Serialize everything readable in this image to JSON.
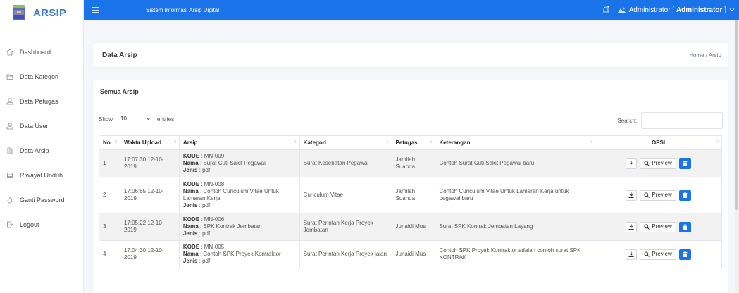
{
  "brand": {
    "name": "ARSIP"
  },
  "topbar": {
    "title": "Sistem Informasi Arsip Digital",
    "user_name": "Administrator",
    "user_role": "Administrator",
    "user_display_prefix": "Administrator [ ",
    "user_display_suffix": " ]"
  },
  "sidebar": {
    "items": [
      {
        "label": "Dashboard",
        "icon": "home-icon"
      },
      {
        "label": "Data Kategori",
        "icon": "folder-icon"
      },
      {
        "label": "Data Petugas",
        "icon": "user-icon"
      },
      {
        "label": "Data User",
        "icon": "user-icon"
      },
      {
        "label": "Data Arsip",
        "icon": "file-icon"
      },
      {
        "label": "Riwayat Unduh",
        "icon": "database-icon"
      },
      {
        "label": "Ganti Password",
        "icon": "lock-icon"
      },
      {
        "label": "Logout",
        "icon": "logout-icon"
      }
    ]
  },
  "header": {
    "title": "Data Arsip",
    "breadcrumb": "Home / Arsip"
  },
  "card": {
    "title": "Semua Arsip",
    "show_label": "Show",
    "entries_value": "10",
    "entries_label": "entries",
    "search_label": "Search:",
    "search_value": ""
  },
  "table": {
    "headers": [
      "No",
      "Waktu Upload",
      "Arsip",
      "Kategori",
      "Petugas",
      "Keterangan",
      "OPSI"
    ],
    "kode_label": "KODE",
    "nama_label": "Nama",
    "jenis_label": "Jenis",
    "preview_label": "Preview",
    "rows": [
      {
        "no": "1",
        "waktu": "17:07:30 12-10-2019",
        "kode": ": MN-009",
        "nama": ": Surat Cuti Sakit Pegawai",
        "jenis": ": pdf",
        "kategori": "Surat Kesehatan Pegawai",
        "petugas": "Jamilah Suanda",
        "keterangan": "Contoh Surat Cuti Sakit Pegawai baru"
      },
      {
        "no": "2",
        "waktu": "17:06:55 12-10-2019",
        "kode": ": MN-008",
        "nama": ": Contoh Curiculum Vitae Untuk Lamaran Kerja",
        "jenis": ": pdf",
        "kategori": "Curiculum Vitae",
        "petugas": "Jamilah Suanda",
        "keterangan": "Contoh Curiculum Vitae Untuk Lamaran Kerja untuk pegawai baru"
      },
      {
        "no": "3",
        "waktu": "17:05:22 12-10-2019",
        "kode": ": MN-006",
        "nama": ": SPK Kontrak Jembatan",
        "jenis": ": pdf",
        "kategori": "Surat Perintah Kerja Proyek Jembatan",
        "petugas": "Junaidi Mus",
        "keterangan": "Surat SPK Kontrak Jembatan Layang"
      },
      {
        "no": "4",
        "waktu": "17:04:30 12-10-2019",
        "kode": ": MN-005",
        "nama": ": Contoh SPK Proyek Kontraktor",
        "jenis": ": pdf",
        "kategori": "Surat Perintah Kerja Proyek jalan",
        "petugas": "Junaidi Mus",
        "keterangan": "Contoh SPK Proyek Kontraktor adalah contoh surat SPK KONTRAK"
      }
    ]
  },
  "colors": {
    "primary": "#1a73e8",
    "brand": "#3d7bd9"
  }
}
